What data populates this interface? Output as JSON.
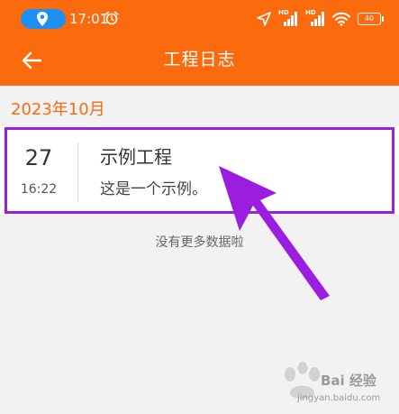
{
  "status_bar": {
    "time": "17:01",
    "signal_label_1": "HD",
    "signal_label_2": "HD",
    "battery": "40"
  },
  "header": {
    "title": "工程日志"
  },
  "log": {
    "month": "2023年10月",
    "entries": [
      {
        "day": "27",
        "time": "16:22",
        "title": "示例工程",
        "description": "这是一个示例。"
      }
    ],
    "no_more_text": "没有更多数据啦"
  },
  "watermark": {
    "text": "Bai 经验",
    "url": "jingyan.baidu.com"
  },
  "colors": {
    "header": "#fb6a0c",
    "accent": "#fb6a0c",
    "location_pill": "#1e8ef3",
    "highlight": "#9b1de0",
    "background": "#f2f2f2"
  },
  "icons": {
    "status_left": [
      "location-pin-icon",
      "alarm-clock-icon"
    ],
    "status_right": [
      "navigation-icon",
      "signal-icon",
      "signal-icon",
      "wifi-icon",
      "battery-icon"
    ],
    "nav": "back-arrow-icon"
  }
}
